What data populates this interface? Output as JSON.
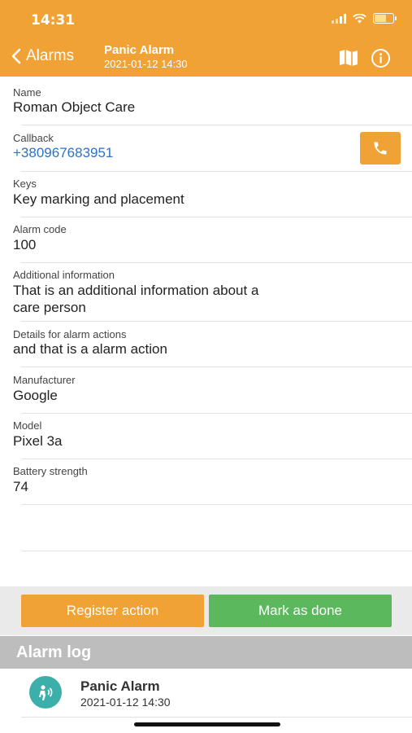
{
  "status": {
    "time": "14:31"
  },
  "header": {
    "back_label": "Alarms",
    "title": "Panic Alarm",
    "subtitle": "2021-01-12 14:30",
    "icons": [
      "map-icon",
      "info-icon"
    ]
  },
  "fields": {
    "name": {
      "label": "Name",
      "value": "Roman Object Care"
    },
    "callback": {
      "label": "Callback",
      "value": "+380967683951"
    },
    "keys": {
      "label": "Keys",
      "value": "Key marking and placement"
    },
    "alarm_code": {
      "label": "Alarm code",
      "value": "100"
    },
    "additional": {
      "label": "Additional information",
      "value_line1": "That is an additional information about a",
      "value_line2": "care person"
    },
    "details": {
      "label": "Details for alarm actions",
      "value": "and that is a alarm action"
    },
    "manufacturer": {
      "label": "Manufacturer",
      "value": "Google"
    },
    "model": {
      "label": "Model",
      "value": "Pixel 3a"
    },
    "battery": {
      "label": "Battery strength",
      "value": "74"
    }
  },
  "actions": {
    "register_label": "Register action",
    "done_label": "Mark as done",
    "colors": {
      "register": "#f0a235",
      "done": "#5cb85c"
    }
  },
  "log": {
    "title": "Alarm log",
    "items": [
      {
        "title": "Panic Alarm",
        "time": "2021-01-12 14:30"
      }
    ]
  },
  "colors": {
    "accent": "#f0a235",
    "link": "#2b73c4",
    "log_icon": "#3dafaa"
  }
}
